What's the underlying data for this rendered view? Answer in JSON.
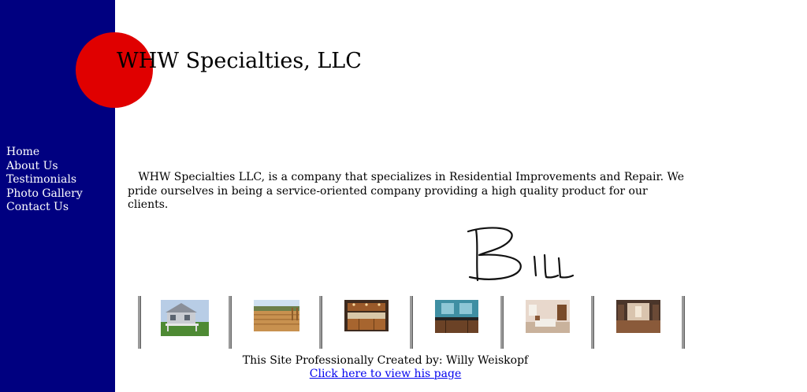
{
  "site": {
    "title": "WHW Specialties, LLC",
    "colors": {
      "sidebar": "#000080",
      "logo_circle": "#e00000",
      "link": "#0000ee"
    }
  },
  "nav": {
    "items": [
      {
        "label": "Home"
      },
      {
        "label": "About Us"
      },
      {
        "label": "Testimonials"
      },
      {
        "label": "Photo Gallery"
      },
      {
        "label": "Contact Us"
      }
    ]
  },
  "main": {
    "intro": "WHW Specialties LLC, is a company that specializes in Residential Improvements and Repair.  We pride ourselves in being a service-oriented company providing a high quality product for our clients.",
    "signature": "Bill"
  },
  "gallery": {
    "thumbnails": [
      {
        "subject": "house-with-deck"
      },
      {
        "subject": "wooden-deck"
      },
      {
        "subject": "kitchen-cabinets"
      },
      {
        "subject": "bathroom-vanity"
      },
      {
        "subject": "bedroom"
      },
      {
        "subject": "room-interior"
      }
    ]
  },
  "footer": {
    "credit": "This Site Professionally Created by: Willy Weiskopf",
    "link": "Click here to view his page"
  }
}
